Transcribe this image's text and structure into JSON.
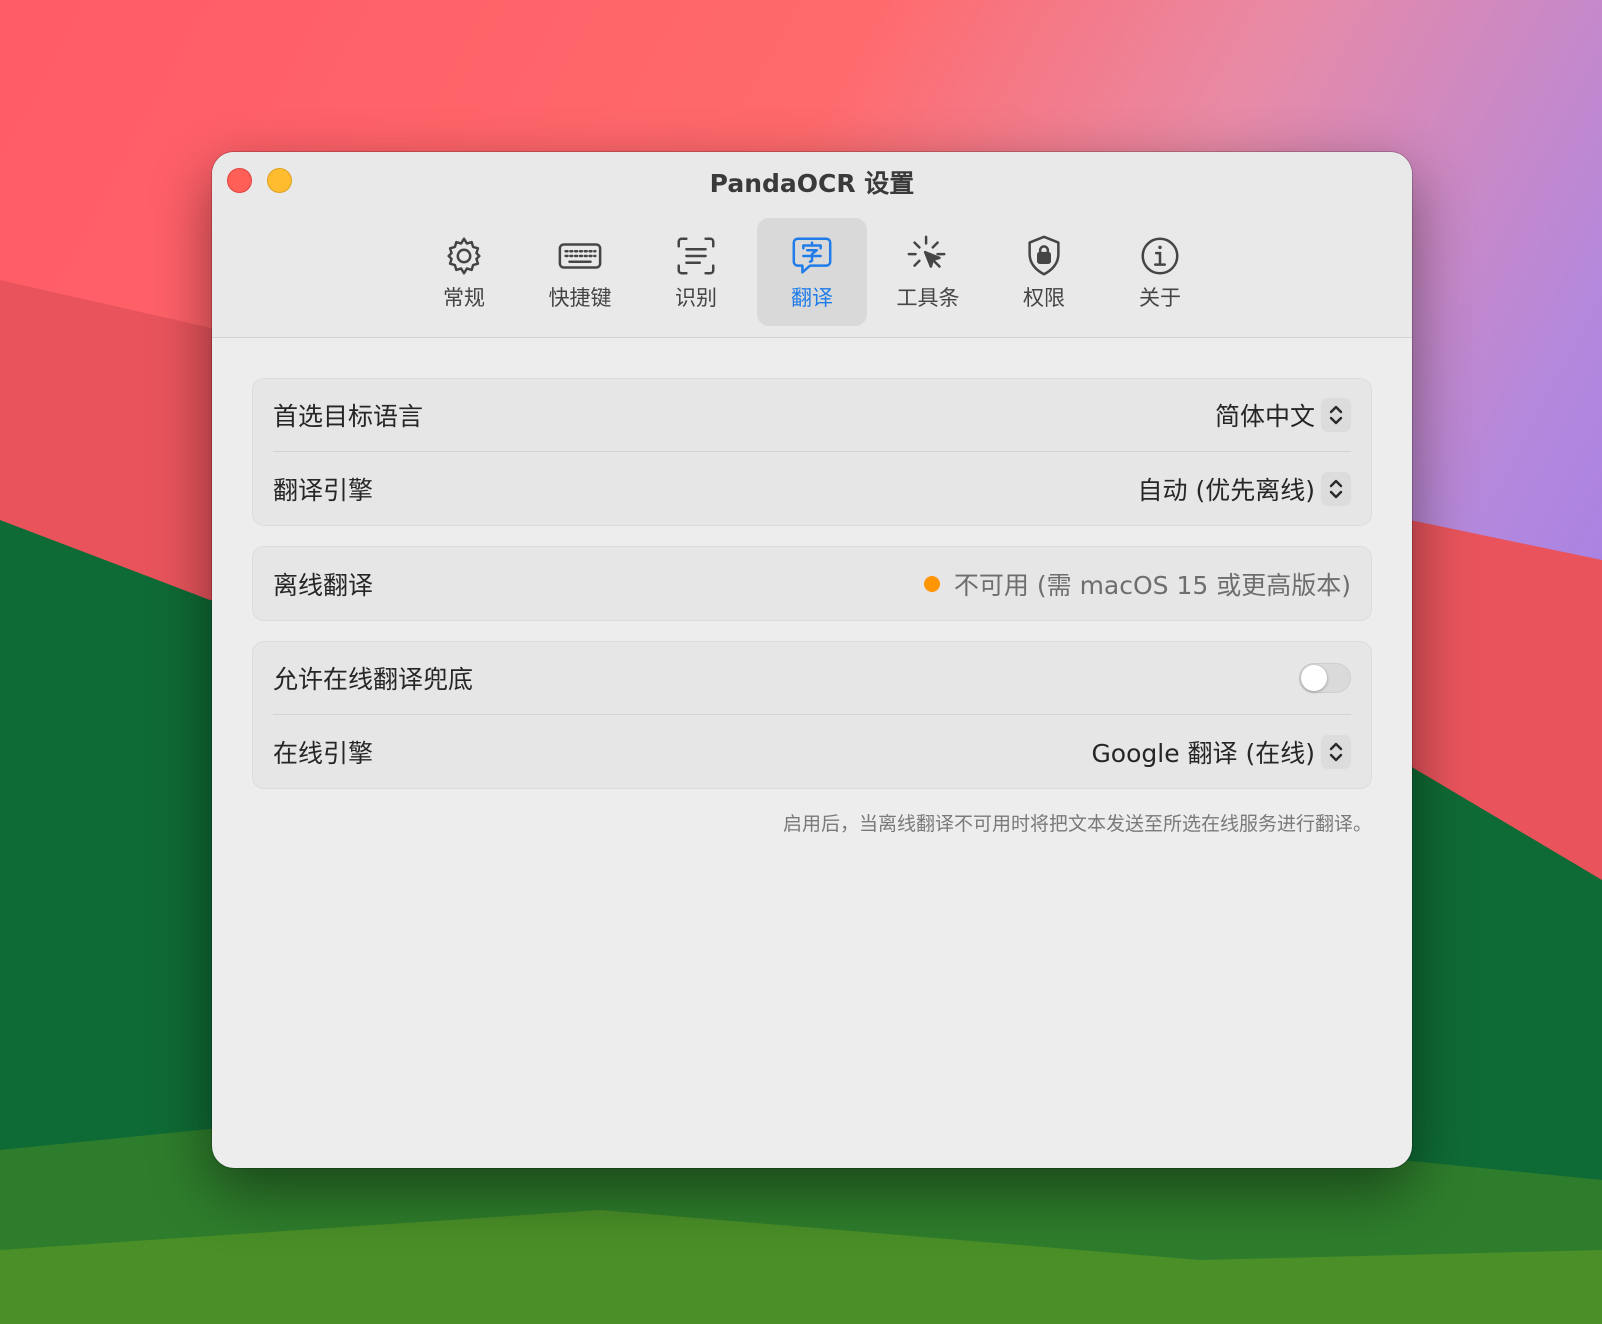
{
  "window": {
    "title": "PandaOCR 设置"
  },
  "tabs": [
    {
      "label": "常规",
      "icon": "gear-icon"
    },
    {
      "label": "快捷键",
      "icon": "keyboard-icon"
    },
    {
      "label": "识别",
      "icon": "text-recognition-icon"
    },
    {
      "label": "翻译",
      "icon": "translate-icon",
      "active": true
    },
    {
      "label": "工具条",
      "icon": "cursor-click-icon"
    },
    {
      "label": "权限",
      "icon": "lock-shield-icon"
    },
    {
      "label": "关于",
      "icon": "info-icon"
    }
  ],
  "settings": {
    "target_language": {
      "label": "首选目标语言",
      "value": "简体中文"
    },
    "engine": {
      "label": "翻译引擎",
      "value": "自动 (优先离线)"
    },
    "offline": {
      "label": "离线翻译",
      "status": "不可用 (需 macOS 15 或更高版本)",
      "status_color": "#ff9500"
    },
    "online_fallback": {
      "label": "允许在线翻译兜底",
      "enabled": false
    },
    "online_engine": {
      "label": "在线引擎",
      "value": "Google 翻译 (在线)"
    },
    "footnote": "启用后，当离线翻译不可用时将把文本发送至所选在线服务进行翻译。"
  },
  "colors": {
    "accent": "#1f7ce8",
    "close": "#ff5f57",
    "minimize": "#febc2e"
  }
}
